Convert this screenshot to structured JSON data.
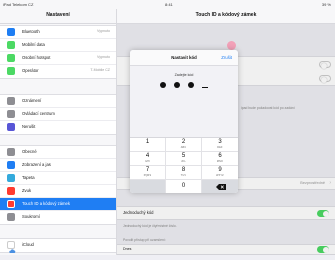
{
  "status_bar": {
    "left": "iPad Telekom CZ",
    "center": "8:41",
    "right": "39 %"
  },
  "sidebar": {
    "title": "Nastavení",
    "group1": [
      {
        "label": "Bluetooth",
        "value": "Vypnuto",
        "icon": "bluetooth-icon",
        "color": "#1f7ef3"
      },
      {
        "label": "Mobilní data",
        "value": "",
        "icon": "antenna-icon",
        "color": "#4cd964"
      },
      {
        "label": "Osobní hotspot",
        "value": "Vypnuto",
        "icon": "hotspot-icon",
        "color": "#4cd964"
      },
      {
        "label": "Operátor",
        "value": "T-Mobile CZ",
        "icon": "phone-icon",
        "color": "#4cd964"
      }
    ],
    "group2": [
      {
        "label": "Oznámení",
        "icon": "notifications-icon",
        "color": "#8e8e93"
      },
      {
        "label": "Ovládací centrum",
        "icon": "control-center-icon",
        "color": "#8e8e93"
      },
      {
        "label": "Nerušit",
        "icon": "moon-icon",
        "color": "#5856d6"
      }
    ],
    "group3": [
      {
        "label": "Obecné",
        "icon": "gear-icon",
        "color": "#8e8e93",
        "selected": false
      },
      {
        "label": "Zobrazení a jas",
        "icon": "display-icon",
        "color": "#1f7ef3",
        "selected": false
      },
      {
        "label": "Tapeta",
        "icon": "wallpaper-icon",
        "color": "#34aadc",
        "selected": false
      },
      {
        "label": "Zvuk",
        "icon": "speaker-icon",
        "color": "#ff3b30",
        "selected": false
      },
      {
        "label": "Touch ID a kódový zámek",
        "icon": "fingerprint-icon",
        "color": "#ff3b30",
        "selected": true
      },
      {
        "label": "Soukromí",
        "icon": "hand-icon",
        "color": "#8e8e93",
        "selected": false
      }
    ],
    "group4": [
      {
        "label": "iCloud",
        "icon": "cloud-icon",
        "color": "#ffffff"
      }
    ]
  },
  "main": {
    "title": "Touch ID a kódový zámek",
    "faded_text": "ipad bude požadovat kód po zadání",
    "simple_code_label": "Jednoduchý kód",
    "simple_code_caption": "Jednoduchý kód je čtyřmístné číslo.",
    "access_caption": "Povolit přístup při uzamčení:",
    "today_label": "Dnes",
    "immediately_value": "Bezprostředně"
  },
  "modal": {
    "title": "Nastavit kód",
    "cancel": "Zrušit",
    "prompt": "Zadejte kód",
    "keys": [
      {
        "n": "1",
        "s": ""
      },
      {
        "n": "2",
        "s": "ABC"
      },
      {
        "n": "3",
        "s": "DEF"
      },
      {
        "n": "4",
        "s": "GHI"
      },
      {
        "n": "5",
        "s": "JKL"
      },
      {
        "n": "6",
        "s": "MNO"
      },
      {
        "n": "7",
        "s": "PQRS"
      },
      {
        "n": "8",
        "s": "TUV"
      },
      {
        "n": "9",
        "s": "WXYZ"
      },
      {
        "n": "",
        "s": ""
      },
      {
        "n": "0",
        "s": ""
      },
      {
        "n": "",
        "s": ""
      }
    ]
  }
}
